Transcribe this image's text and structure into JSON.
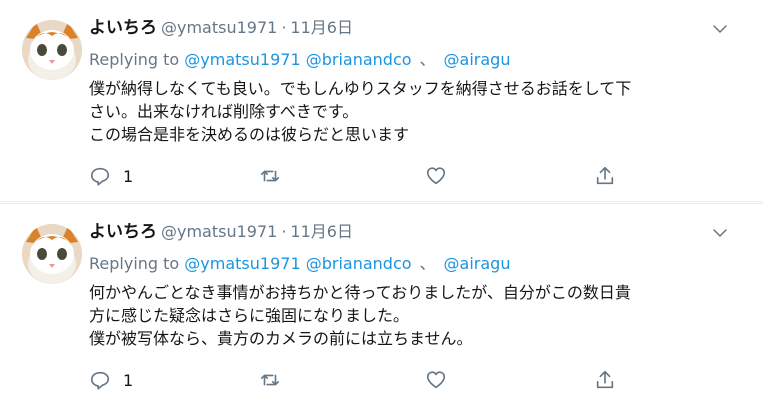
{
  "tweets": [
    {
      "name": "よいちろ",
      "handle": "@ymatsu1971",
      "separator": "·",
      "date": "11月6日",
      "replying_prefix": "Replying to",
      "mention1": "@ymatsu1971",
      "mention2": "@brianandco",
      "reply_sep": "、",
      "mention3": "@airagu",
      "lines": [
        "僕が納得しなくても良い。でもしんゆりスタッフを納得させるお話をして下",
        "さい。出来なければ削除すべきです。",
        "この場合是非を決めるのは彼らだと思います"
      ],
      "reply_count": "1"
    },
    {
      "name": "よいちろ",
      "handle": "@ymatsu1971",
      "separator": "·",
      "date": "11月6日",
      "replying_prefix": "Replying to",
      "mention1": "@ymatsu1971",
      "mention2": "@brianandco",
      "reply_sep": "、",
      "mention3": "@airagu",
      "lines": [
        "何かやんごとなき事情がお持ちかと待っておりましたが、自分がこの数日貴",
        "方に感じた疑念はさらに強固になりました。",
        "僕が被写体なら、貴方のカメラの前には立ちません。"
      ],
      "reply_count": "1"
    }
  ],
  "icons": {
    "reply": "reply-icon",
    "retweet": "retweet-icon",
    "like": "heart-icon",
    "share": "share-icon",
    "caret": "chevron-down-icon"
  },
  "colors": {
    "link": "#1b95e0",
    "muted": "#657786",
    "text": "#14171a",
    "divider": "#e6ecf0"
  }
}
